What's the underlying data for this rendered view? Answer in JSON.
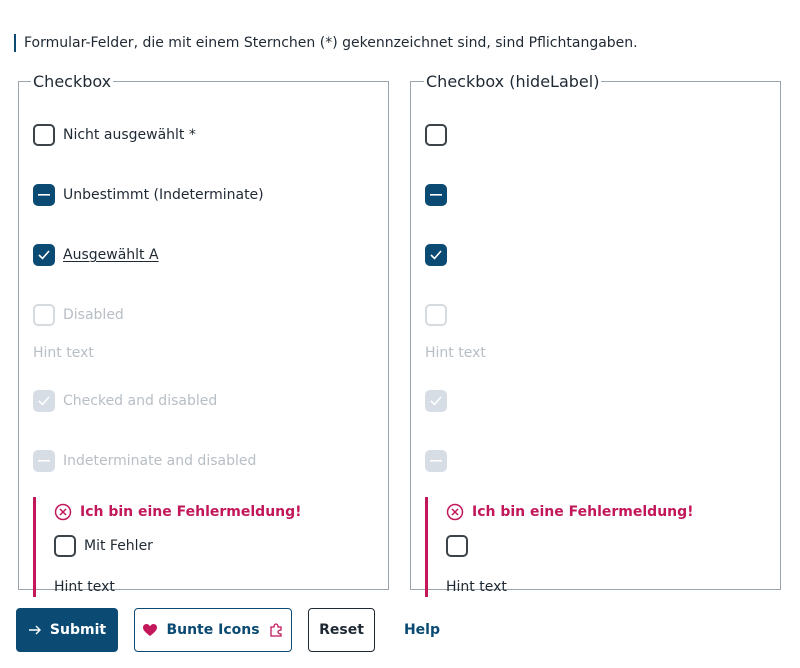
{
  "note": "Formular-Felder, die mit einem Sternchen (*) gekennzeichnet sind, sind Pflichtangaben.",
  "left": {
    "legend": "Checkbox",
    "items": {
      "unchecked": "Nicht ausgewählt *",
      "indeterminate": "Unbestimmt (Indeterminate)",
      "checked": "Ausgewählt A",
      "disabled": "Disabled",
      "hint": "Hint text",
      "checked_disabled": "Checked and disabled",
      "indeterminate_disabled": "Indeterminate and disabled"
    },
    "error": {
      "message": "Ich bin eine Fehlermeldung!",
      "label": "Mit Fehler",
      "hint": "Hint text"
    }
  },
  "right": {
    "legend": "Checkbox (hideLabel)",
    "hint": "Hint text",
    "error": {
      "message": "Ich bin eine Fehlermeldung!",
      "hint": "Hint text"
    }
  },
  "buttons": {
    "submit": "Submit",
    "bunte": "Bunte Icons",
    "reset": "Reset",
    "help": "Help"
  },
  "colors": {
    "primary": "#0b4a72",
    "error": "#c2185b",
    "disabled": "#b7bec5"
  }
}
